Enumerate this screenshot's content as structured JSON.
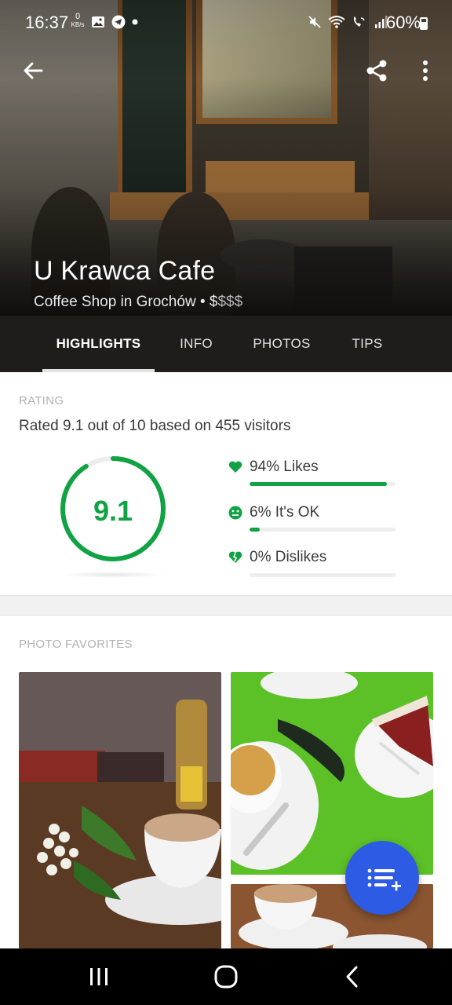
{
  "status_bar": {
    "time": "16:37",
    "net_speed_value": "0",
    "net_speed_unit": "KB/s",
    "battery": "60%"
  },
  "hero": {
    "venue_name": "U Krawca Cafe",
    "subtitle": "Coffee Shop in Grochów • ",
    "price_active": "$",
    "price_inactive": "$$$"
  },
  "tabs": [
    {
      "label": "HIGHLIGHTS",
      "active": true
    },
    {
      "label": "INFO",
      "active": false
    },
    {
      "label": "PHOTOS",
      "active": false
    },
    {
      "label": "TIPS",
      "active": false
    }
  ],
  "rating": {
    "section_label": "RATING",
    "sentence": "Rated 9.1 out of 10 based on 455 visitors",
    "score": "9.1",
    "score_value": 9.1,
    "score_max": 10,
    "stats": [
      {
        "label": "94% Likes",
        "fraction": 0.94,
        "icon": "heart-icon"
      },
      {
        "label": "6% It's OK",
        "fraction": 0.06,
        "icon": "neutral-face-icon"
      },
      {
        "label": "0% Dislikes",
        "fraction": 0.0,
        "icon": "broken-heart-icon"
      }
    ]
  },
  "photos": {
    "section_label": "PHOTO FAVORITES"
  },
  "colors": {
    "accent_green": "#10a243",
    "fab_blue": "#2d5be3"
  },
  "icons": {
    "back": "back-arrow-icon",
    "share": "share-icon",
    "more": "more-vert-icon",
    "fab": "add-to-list-icon"
  }
}
